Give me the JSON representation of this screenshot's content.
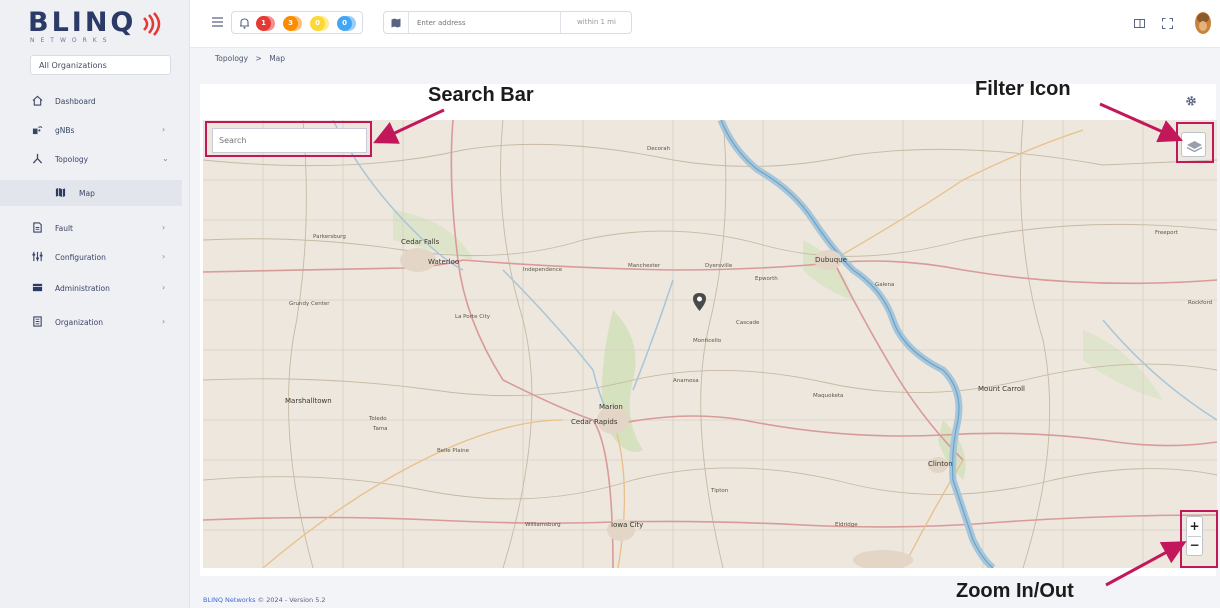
{
  "brand": {
    "name": "BLINQ",
    "tagline": "NETWORKS"
  },
  "org_selector": {
    "value": "All Organizations"
  },
  "sidebar": {
    "items": [
      {
        "label": "Dashboard",
        "icon": "home-icon",
        "has_children": false
      },
      {
        "label": "gNBs",
        "icon": "gnb-icon",
        "has_children": true
      },
      {
        "label": "Topology",
        "icon": "topology-icon",
        "has_children": true,
        "expanded": true
      },
      {
        "label": "Fault",
        "icon": "fault-icon",
        "has_children": true
      },
      {
        "label": "Configuration",
        "icon": "configuration-icon",
        "has_children": true
      },
      {
        "label": "Administration",
        "icon": "administration-icon",
        "has_children": true
      },
      {
        "label": "Organization",
        "icon": "organization-icon",
        "has_children": true
      }
    ],
    "sub_items": [
      {
        "label": "Map",
        "icon": "map-icon",
        "active": true
      }
    ]
  },
  "topbar": {
    "alert_counts": [
      {
        "count": "1",
        "color": "#e53935"
      },
      {
        "count": "3",
        "color": "#fb8c00"
      },
      {
        "count": "0",
        "color": "#fdd835"
      },
      {
        "count": "0",
        "color": "#42a5f5"
      }
    ],
    "address": {
      "placeholder": "Enter address",
      "radius": "within 1 mi"
    }
  },
  "breadcrumb": {
    "parent": "Topology",
    "separator": ">",
    "current": "Map"
  },
  "map": {
    "search_placeholder": "Search",
    "zoom_in": "+",
    "zoom_out": "−",
    "places": [
      "Cedar Falls",
      "Waterloo",
      "Dubuque",
      "Marion",
      "Cedar Rapids",
      "Iowa City",
      "Mount Carroll",
      "Marshalltown",
      "Manchester",
      "Independence",
      "Dyersville",
      "Monticello",
      "Anamosa",
      "Tama",
      "Clinton",
      "La Porte City",
      "Grundy Center",
      "Parkersburg",
      "Decorah",
      "Galena",
      "Epworth",
      "Cascade",
      "Maquoketa",
      "Toledo",
      "Belle Plaine",
      "Williamsburg",
      "Tipton",
      "Eldridge",
      "Rockford",
      "Freeport"
    ]
  },
  "annotations": {
    "search_bar": "Search Bar",
    "filter_icon": "Filter Icon",
    "zoom": "Zoom In/Out",
    "color": "#c2185b"
  },
  "footer": {
    "brand": "BLINQ Networks",
    "text": "© 2024 - Version 5.2"
  }
}
